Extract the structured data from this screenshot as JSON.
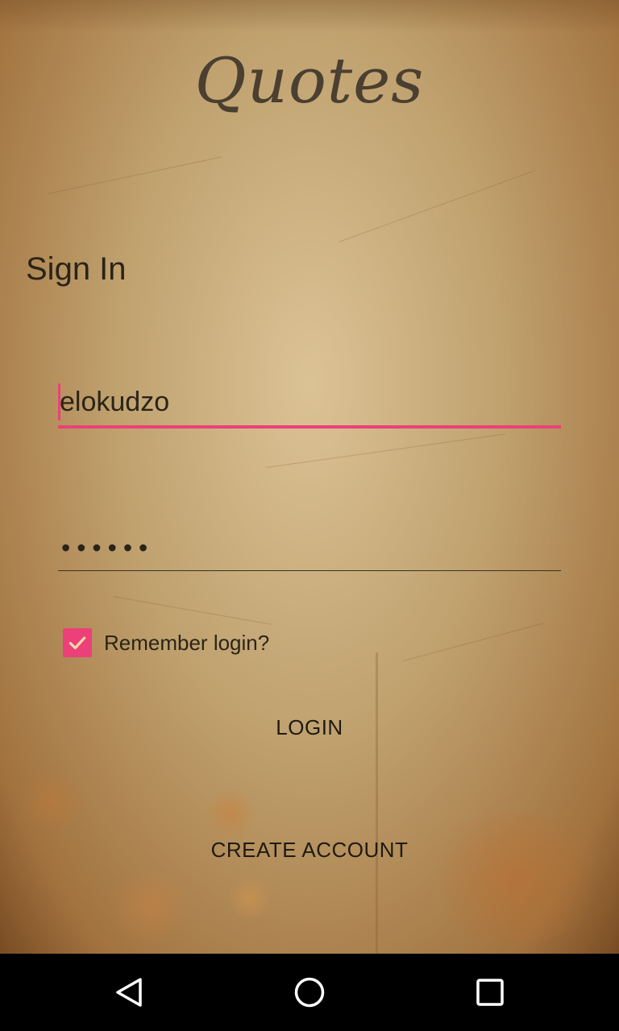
{
  "app": {
    "logo_text": "Quotes"
  },
  "sign_in": {
    "title": "Sign In",
    "username_value": "elokudzo",
    "password_masked": "••••••",
    "remember_label": "Remember login?",
    "remember_checked": true,
    "login_label": "LOGIN",
    "create_account_label": "CREATE ACCOUNT"
  },
  "colors": {
    "accent": "#ec407a",
    "text": "#2a2418",
    "navbar": "#000000"
  },
  "navbar": {
    "icons": [
      "back-icon",
      "home-icon",
      "recents-icon"
    ]
  }
}
